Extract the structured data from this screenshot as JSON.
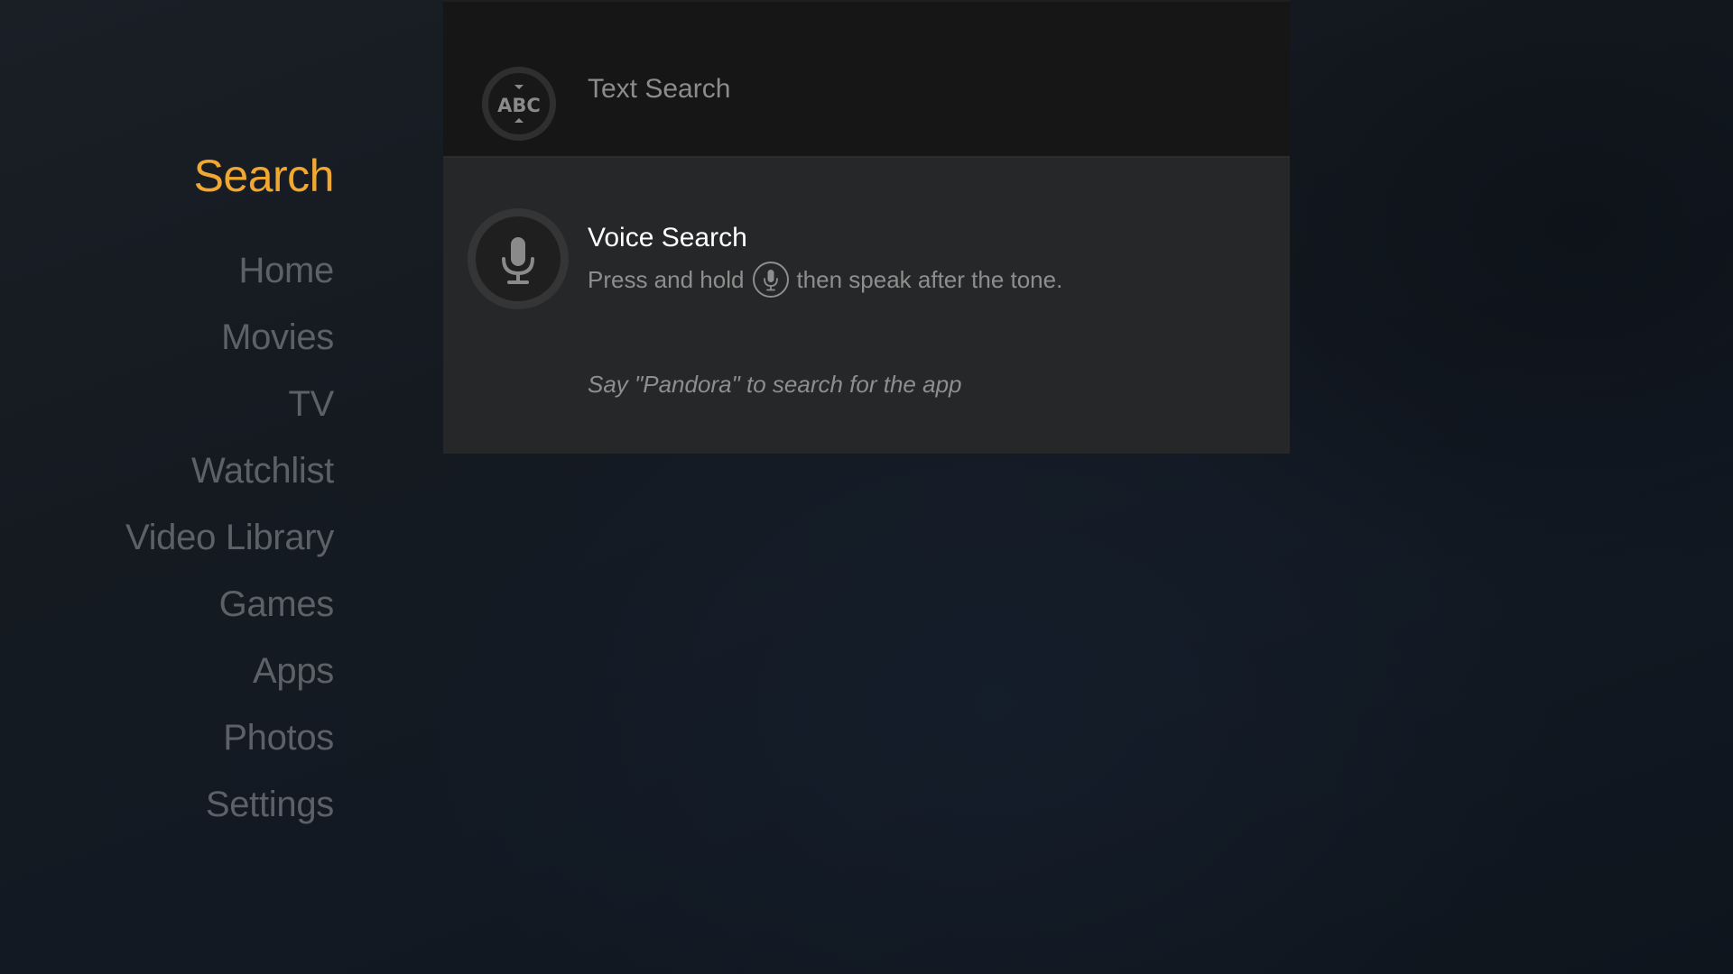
{
  "nav": {
    "active": "Search",
    "items": [
      "Home",
      "Movies",
      "TV",
      "Watchlist",
      "Video Library",
      "Games",
      "Apps",
      "Photos",
      "Settings"
    ]
  },
  "search_options": {
    "text_search": {
      "label": "Text Search",
      "icon": "abc-keyboard-icon",
      "icon_text": "ABC"
    },
    "voice_search": {
      "label": "Voice Search",
      "icon": "microphone-icon",
      "hint_before": "Press and hold",
      "hint_icon": "microphone-button-icon",
      "hint_after": "then speak after the tone.",
      "tip": "Say \"Pandora\" to search for the app"
    }
  },
  "colors": {
    "accent": "#f0a832",
    "nav_inactive": "#5c6168",
    "panel_selected": "#262728",
    "panel_unselected": "#161616"
  }
}
